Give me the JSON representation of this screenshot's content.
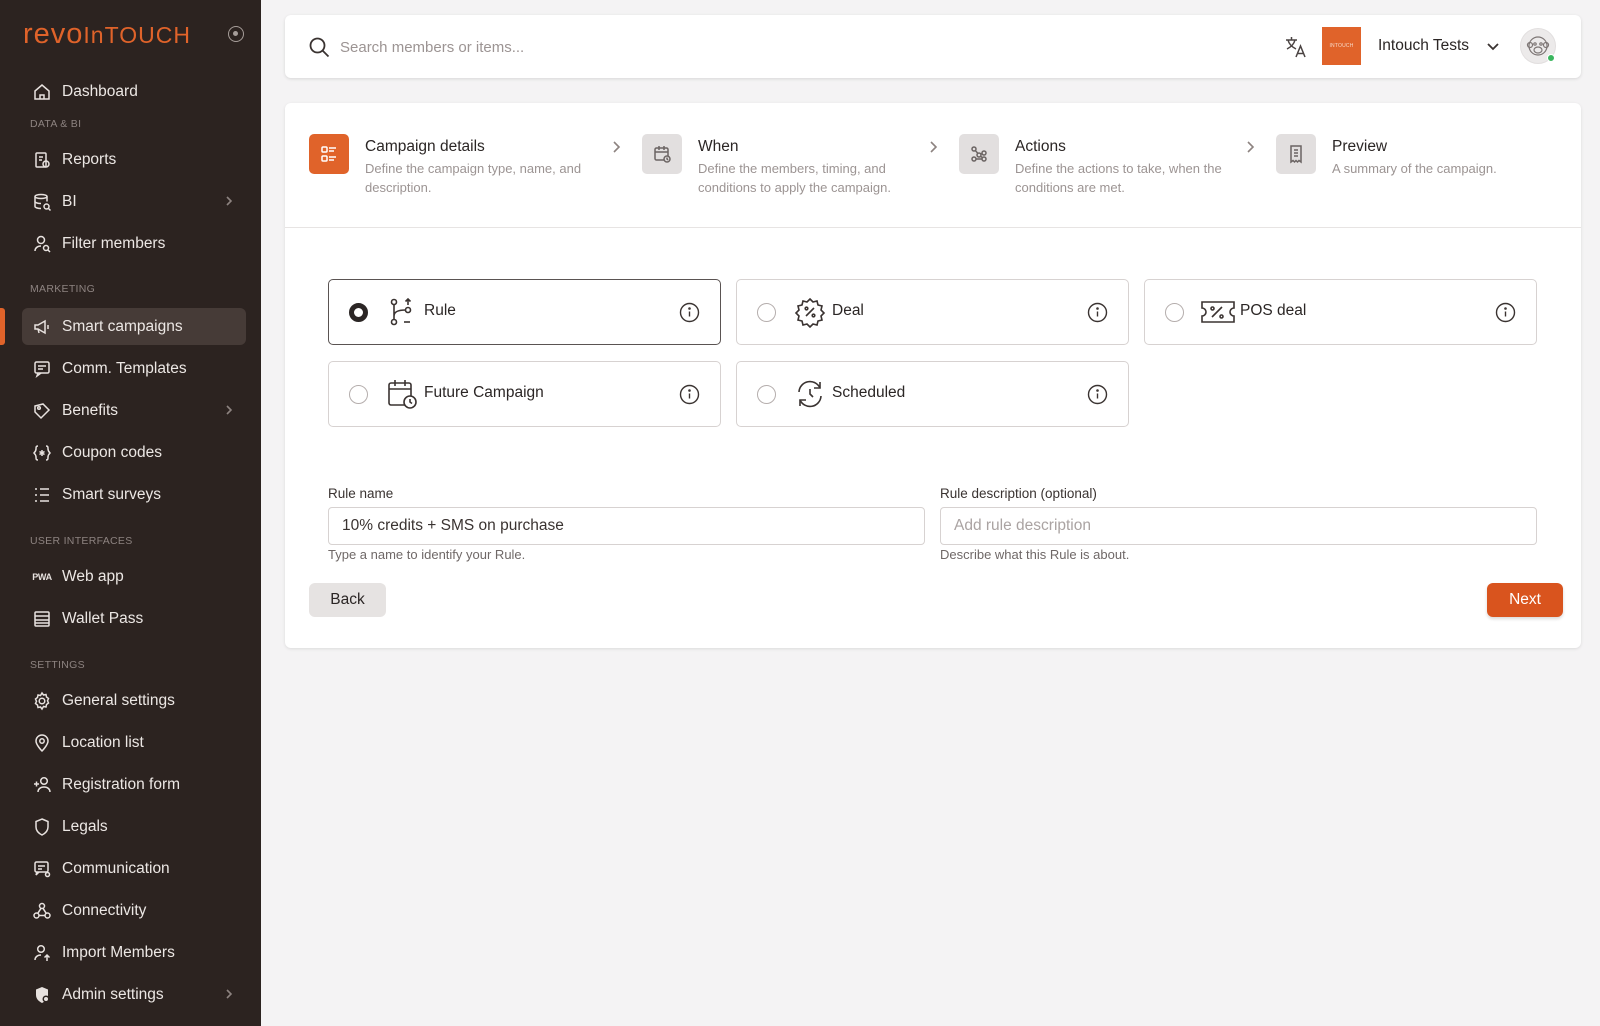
{
  "brand": {
    "part1": "revo",
    "part2": "InTOUCH"
  },
  "sidebar": {
    "sections": {
      "data_bi": "DATA & BI",
      "marketing": "MARKETING",
      "user_interfaces": "USER INTERFACES",
      "settings": "SETTINGS"
    },
    "items": [
      {
        "label": "Dashboard",
        "icon": "home-icon"
      },
      {
        "label": "Reports",
        "icon": "reports-icon"
      },
      {
        "label": "BI",
        "icon": "database-search-icon"
      },
      {
        "label": "Filter members",
        "icon": "user-search-icon"
      },
      {
        "label": "Smart campaigns",
        "icon": "megaphone-icon"
      },
      {
        "label": "Comm. Templates",
        "icon": "message-icon"
      },
      {
        "label": "Benefits",
        "icon": "tag-icon"
      },
      {
        "label": "Coupon codes",
        "icon": "code-braces-icon"
      },
      {
        "label": "Smart surveys",
        "icon": "list-icon"
      },
      {
        "label": "Web app",
        "icon": "pwa-icon"
      },
      {
        "label": "Wallet Pass",
        "icon": "wallet-icon"
      },
      {
        "label": "General settings",
        "icon": "gear-icon"
      },
      {
        "label": "Location list",
        "icon": "location-pin-icon"
      },
      {
        "label": "Registration form",
        "icon": "user-add-icon"
      },
      {
        "label": "Legals",
        "icon": "shield-icon"
      },
      {
        "label": "Communication",
        "icon": "message-settings-icon"
      },
      {
        "label": "Connectivity",
        "icon": "webhook-icon"
      },
      {
        "label": "Import Members",
        "icon": "user-upload-icon"
      },
      {
        "label": "Admin settings",
        "icon": "admin-icon"
      }
    ],
    "pwa_badge": "PWA"
  },
  "topbar": {
    "search_placeholder": "Search members or items...",
    "org_logo_text": "INTOUCH",
    "org_name": "Intouch Tests"
  },
  "steps": [
    {
      "title": "Campaign details",
      "desc": "Define the campaign type, name, and description."
    },
    {
      "title": "When",
      "desc": "Define the members, timing, and conditions to apply the campaign."
    },
    {
      "title": "Actions",
      "desc": "Define the actions to take, when the conditions are met."
    },
    {
      "title": "Preview",
      "desc": "A summary of the campaign."
    }
  ],
  "campaign_types": [
    {
      "label": "Rule",
      "selected": true
    },
    {
      "label": "Deal",
      "selected": false
    },
    {
      "label": "POS deal",
      "selected": false
    },
    {
      "label": "Future Campaign",
      "selected": false
    },
    {
      "label": "Scheduled",
      "selected": false
    }
  ],
  "form": {
    "rule_name_label": "Rule name",
    "rule_name_value": "10% credits + SMS on purchase",
    "rule_name_help": "Type a name to identify your Rule.",
    "rule_desc_label": "Rule description (optional)",
    "rule_desc_placeholder": "Add rule description",
    "rule_desc_help": "Describe what this Rule is about."
  },
  "buttons": {
    "back": "Back",
    "next": "Next"
  },
  "colors": {
    "accent": "#e0632a",
    "sidebar_bg": "#2c2320",
    "online": "#3ab65e"
  }
}
